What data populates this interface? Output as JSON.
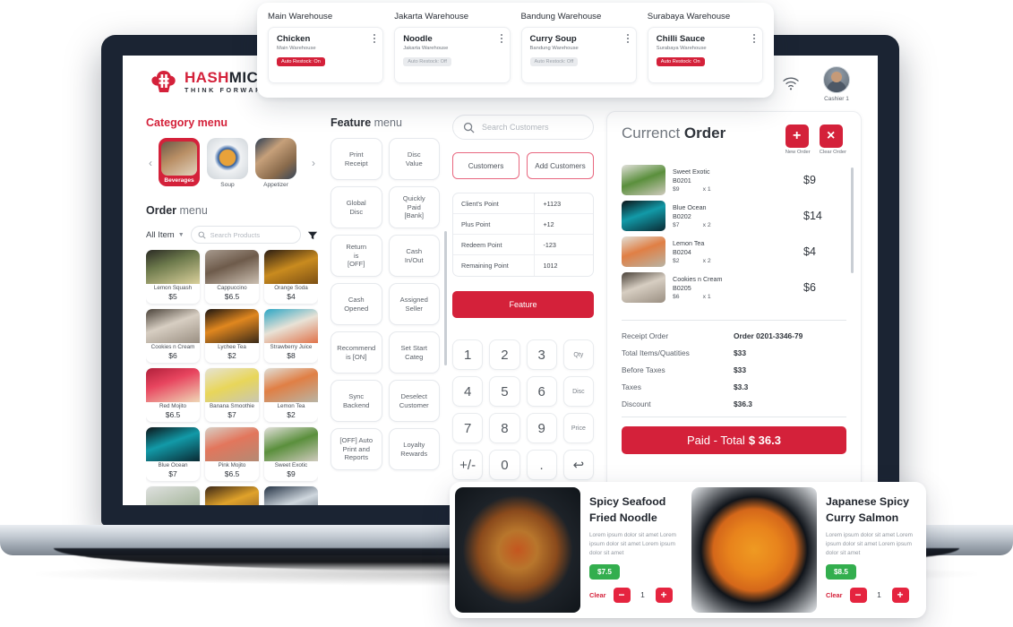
{
  "warehouse_panel": {
    "columns": [
      {
        "header": "Main Warehouse",
        "name": "Chicken",
        "sub": "Main Warehouse",
        "badge": "Auto Restock: On",
        "badge_state": "on"
      },
      {
        "header": "Jakarta Warehouse",
        "name": "Noodle",
        "sub": "Jakarta Warehouse",
        "badge": "Auto Restock: Off",
        "badge_state": "off"
      },
      {
        "header": "Bandung Warehouse",
        "name": "Curry Soup",
        "sub": "Bandung Warehouse",
        "badge": "Auto Restock: Off",
        "badge_state": "off"
      },
      {
        "header": "Surabaya Warehouse",
        "name": "Chilli Sauce",
        "sub": "Surabaya Warehouse",
        "badge": "Auto Restock: On",
        "badge_state": "on"
      }
    ]
  },
  "header": {
    "logo_primary": "HASH",
    "logo_secondary": "MICRO",
    "logo_tagline": "THINK FORWARD",
    "user_name": "Cashier 1"
  },
  "category": {
    "title_text": "Category menu",
    "prev": "‹",
    "next": "›",
    "items": [
      {
        "label": "Beverages",
        "active": true
      },
      {
        "label": "Soup",
        "active": false
      },
      {
        "label": "Appetizer",
        "active": false
      }
    ]
  },
  "order_menu": {
    "title_bold": "Order",
    "title_normal": " menu",
    "filter_label": "All Item",
    "search_placeholder": "Search Products",
    "products": [
      {
        "name": "Lemon Squash",
        "price": "$5"
      },
      {
        "name": "Cappuccino",
        "price": "$6.5"
      },
      {
        "name": "Orange Soda",
        "price": "$4"
      },
      {
        "name": "Cookies n  Cream",
        "price": "$6"
      },
      {
        "name": "Lychee Tea",
        "price": "$2"
      },
      {
        "name": "Strawberry Juice",
        "price": "$8"
      },
      {
        "name": "Red Mojito",
        "price": "$6.5"
      },
      {
        "name": "Banana Smoothie",
        "price": "$7"
      },
      {
        "name": "Lemon Tea",
        "price": "$2"
      },
      {
        "name": "Blue Ocean",
        "price": "$7"
      },
      {
        "name": "Pink Mojito",
        "price": "$6.5"
      },
      {
        "name": "Sweet Exotic",
        "price": "$9"
      },
      {
        "name": "",
        "price": ""
      },
      {
        "name": "",
        "price": ""
      },
      {
        "name": "",
        "price": ""
      }
    ]
  },
  "feature_menu": {
    "title_bold": "Feature",
    "title_normal": " menu",
    "buttons": [
      "Print\nReceipt",
      "Disc\nValue",
      "Global\nDisc",
      "Quickly\nPaid\n[Bank]",
      "Return\nis\n[OFF]",
      "Cash\nIn/Out",
      "Cash\nOpened",
      "Assigned\nSeller",
      "Recommend\nis [ON]",
      "Set Start\nCateg",
      "Sync\nBackend",
      "Deselect\nCustomer",
      "[OFF] Auto\nPrint and\nReports",
      "Loyalty\nRewards"
    ]
  },
  "customer": {
    "search_placeholder": "Search Customers",
    "customers_button": "Customers",
    "add_customers_button": "Add Customers",
    "points": [
      {
        "label": "Client's Point",
        "value": "+1123"
      },
      {
        "label": "Plus Point",
        "value": "+12"
      },
      {
        "label": "Redeem Point",
        "value": "-123"
      },
      {
        "label": "Remaining Point",
        "value": "1012"
      }
    ],
    "feature_button": "Feature"
  },
  "keypad": {
    "keys": [
      {
        "label": "1",
        "type": "num"
      },
      {
        "label": "2",
        "type": "num"
      },
      {
        "label": "3",
        "type": "num"
      },
      {
        "label": "Qty",
        "type": "lbl"
      },
      {
        "label": "4",
        "type": "num"
      },
      {
        "label": "5",
        "type": "num"
      },
      {
        "label": "6",
        "type": "num"
      },
      {
        "label": "Disc",
        "type": "lbl"
      },
      {
        "label": "7",
        "type": "num"
      },
      {
        "label": "8",
        "type": "num"
      },
      {
        "label": "9",
        "type": "num"
      },
      {
        "label": "Price",
        "type": "lbl"
      },
      {
        "label": "+/-",
        "type": "num"
      },
      {
        "label": "0",
        "type": "num"
      },
      {
        "label": ".",
        "type": "num"
      },
      {
        "label": "↩",
        "type": "num"
      }
    ]
  },
  "current_order": {
    "title_normal": "Currenct ",
    "title_bold": "Order",
    "new_order_glyph": "+",
    "new_order_label": "New Order",
    "clear_order_glyph": "×",
    "clear_order_label": "Clear Order",
    "items": [
      {
        "name": "Sweet Exotic",
        "code": "B0201",
        "price": "$9",
        "qty": "x 1",
        "total": "$9"
      },
      {
        "name": "Blue Ocean",
        "code": "B0202",
        "price": "$7",
        "qty": "x 2",
        "total": "$14"
      },
      {
        "name": "Lemon Tea",
        "code": "B0204",
        "price": "$2",
        "qty": "x 2",
        "total": "$4"
      },
      {
        "name": "Cookies n Cream",
        "code": "B0205",
        "price": "$6",
        "qty": "x 1",
        "total": "$6"
      }
    ],
    "summary": [
      {
        "label": "Receipt Order",
        "value": "Order 0201-3346-79"
      },
      {
        "label": "Total Items/Quatities",
        "value": "$33"
      },
      {
        "label": "Before Taxes",
        "value": "$33"
      },
      {
        "label": "Taxes",
        "value": "$3.3"
      },
      {
        "label": "Discount",
        "value": "$36.3"
      }
    ],
    "paid_label": "Paid - Total ",
    "paid_amount": "$ 36.3"
  },
  "food_float": {
    "cards": [
      {
        "title": "Spicy Seafood\nFried Noodle",
        "desc": "Lorem ipsum dolor sit amet Lorem ipsum dolor sit amet Lorem ipsum dolor sit amet",
        "price": "$7.5",
        "clear": "Clear",
        "minus": "−",
        "qty": "1",
        "plus": "+"
      },
      {
        "title": "Japanese Spicy\nCurry Salmon",
        "desc": "Lorem ipsum dolor sit amet Lorem ipsum dolor sit amet Lorem ipsum dolor sit amet",
        "price": "$8.5",
        "clear": "Clear",
        "minus": "−",
        "qty": "1",
        "plus": "+"
      }
    ]
  },
  "colors": {
    "brand_red": "#d4213a",
    "accent_green": "#33ae4e",
    "bezel": "#1b2433"
  }
}
